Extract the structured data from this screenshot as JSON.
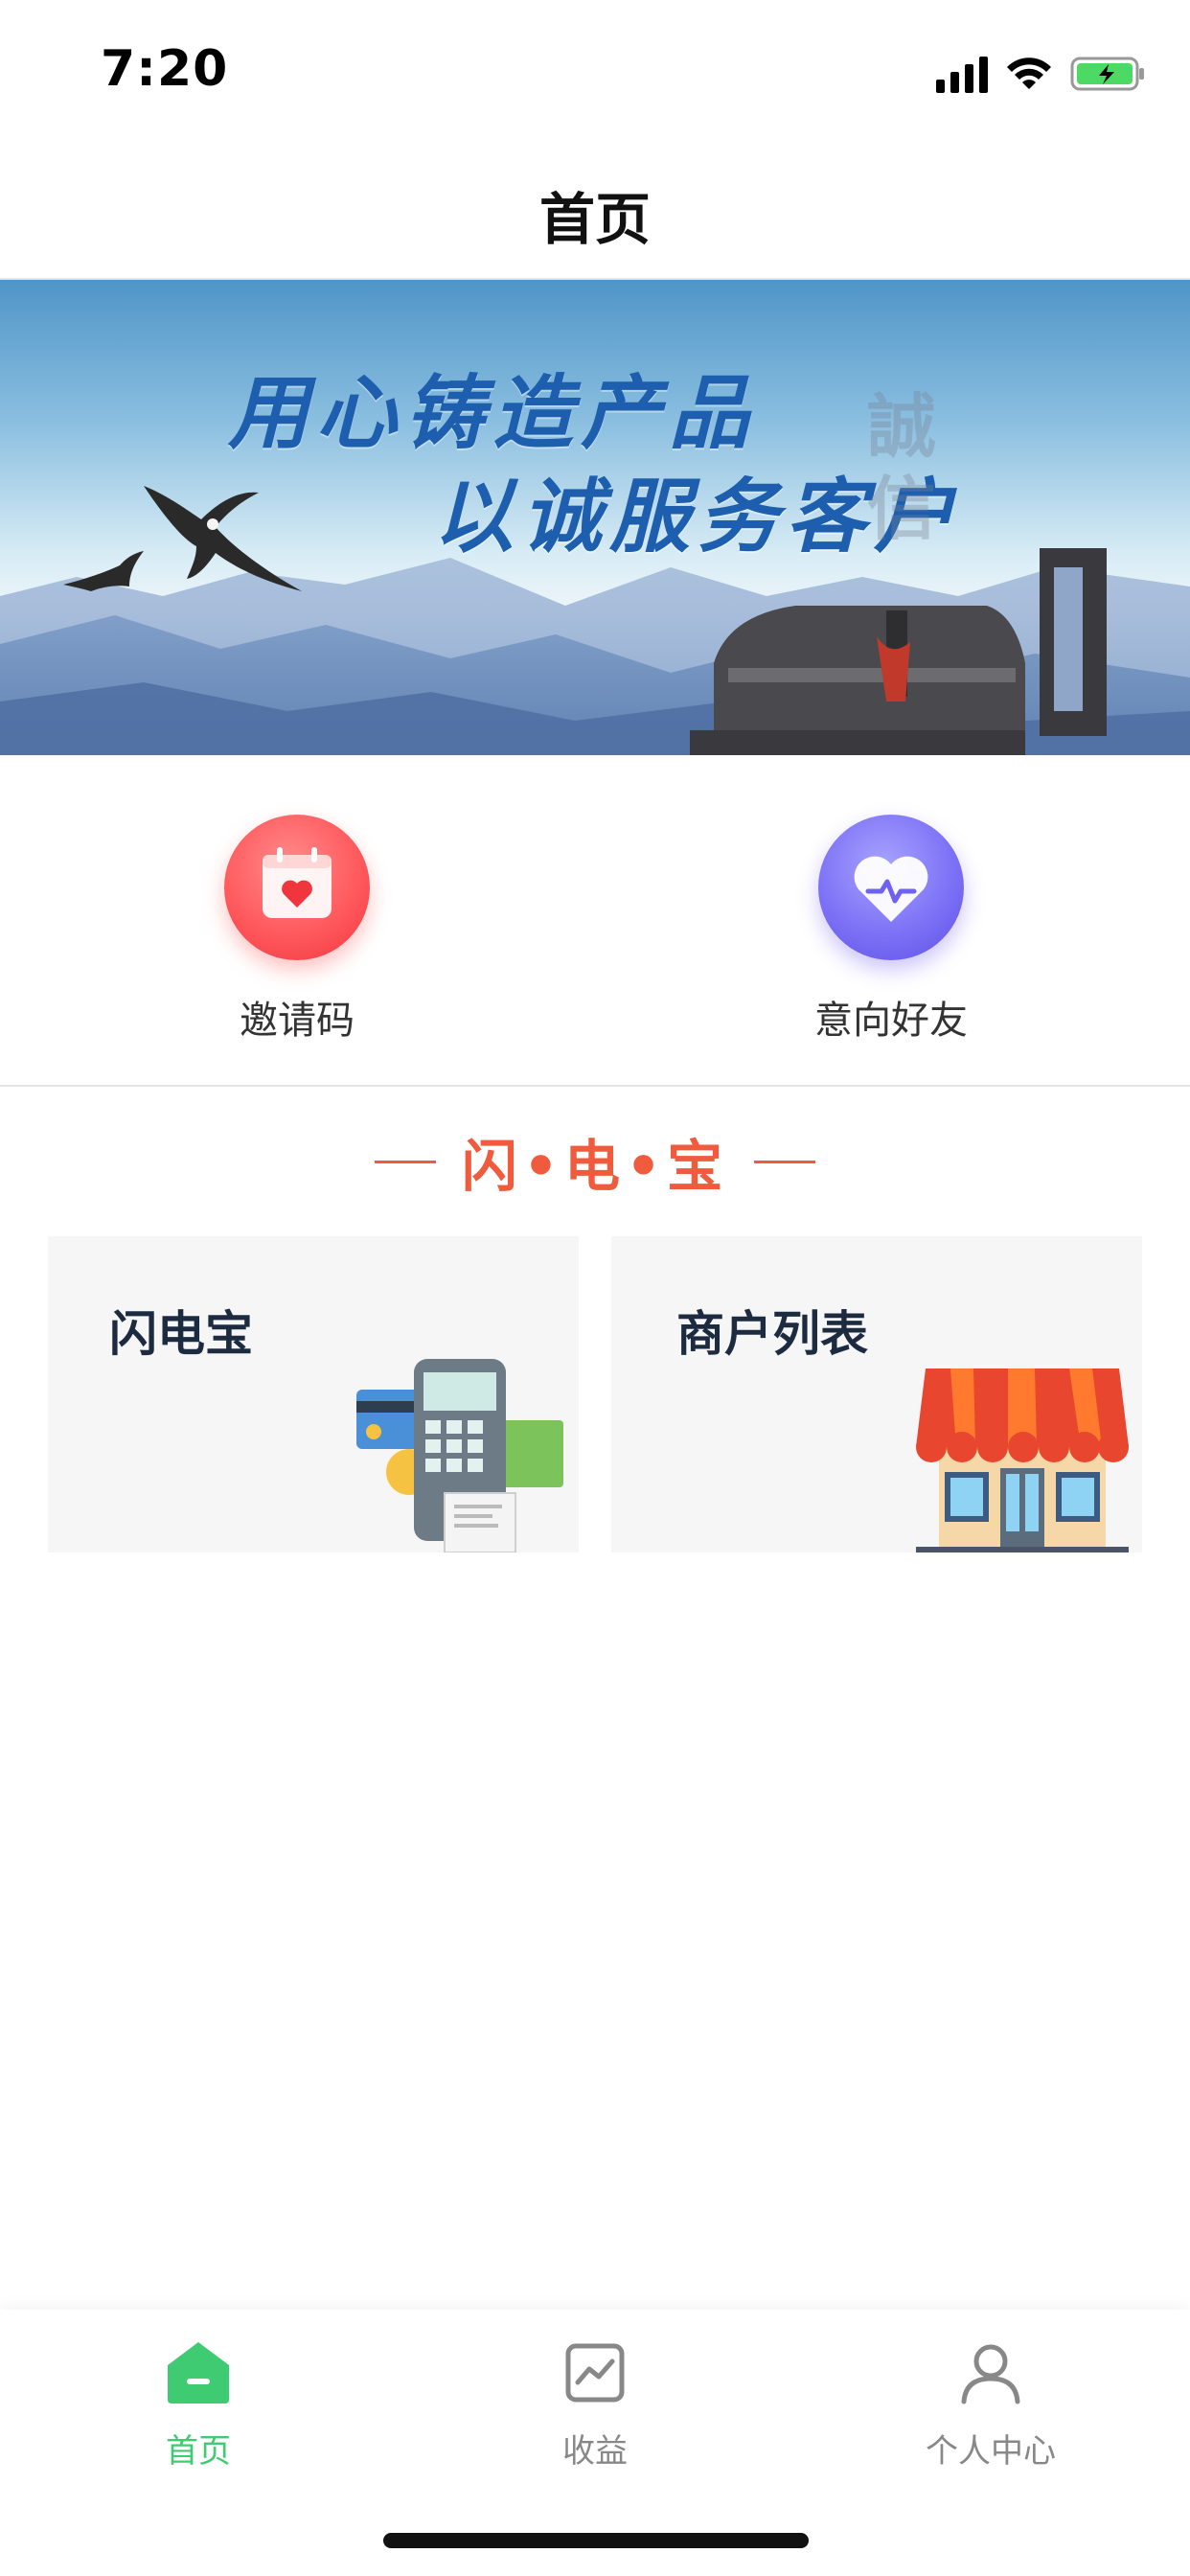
{
  "status_bar": {
    "time": "7:20"
  },
  "nav": {
    "title": "首页"
  },
  "banner": {
    "line1": "用心铸造产品",
    "line2": "以诚服务客户",
    "watermark": "誠信"
  },
  "quick_actions": [
    {
      "label": "邀请码",
      "icon": "calendar-heart-icon",
      "color": "#ff5a5e"
    },
    {
      "label": "意向好友",
      "icon": "heart-pulse-icon",
      "color": "#7d72f6"
    }
  ],
  "section": {
    "title": "闪•电•宝",
    "accent_color": "#ef5b3c"
  },
  "cards": [
    {
      "title": "闪电宝",
      "icon": "pos-terminal-icon"
    },
    {
      "title": "商户列表",
      "icon": "storefront-icon"
    }
  ],
  "tab_bar": {
    "active_color": "#3ecb72",
    "tabs": [
      {
        "label": "首页",
        "icon": "home-icon",
        "active": true
      },
      {
        "label": "收益",
        "icon": "chart-icon",
        "active": false
      },
      {
        "label": "个人中心",
        "icon": "user-icon",
        "active": false
      }
    ]
  }
}
